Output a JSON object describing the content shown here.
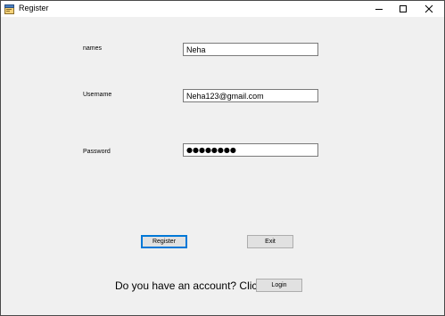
{
  "window": {
    "title": "Register",
    "icons": {
      "app": "app-form-icon",
      "minimize": "minimize-icon",
      "maximize": "maximize-icon",
      "close": "close-icon"
    }
  },
  "form": {
    "names_label": "names",
    "names_value": "Neha",
    "username_label": "Username",
    "username_value": "Neha123@gmail.com",
    "password_label": "Password",
    "password_value": "●●●●●●●●"
  },
  "buttons": {
    "register": "Register",
    "exit": "Exit",
    "login": "Login"
  },
  "footer": {
    "prompt": "Do you have an account? Click"
  }
}
